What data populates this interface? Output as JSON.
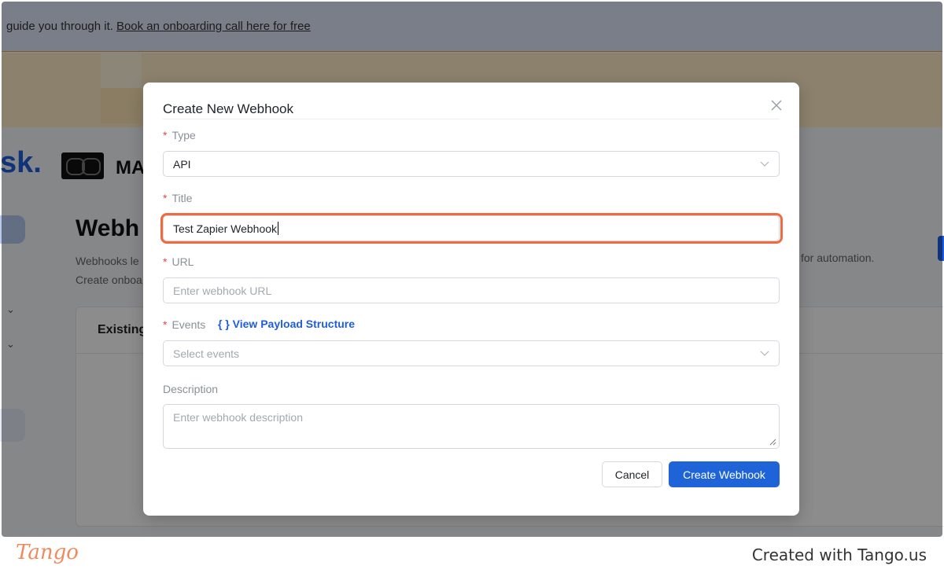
{
  "banner": {
    "text": "guide you through it.",
    "link": "Book an onboarding call here for free"
  },
  "background": {
    "logo_fragment": "sk.",
    "brand_fragment": "MA",
    "page_title_fragment": "Webh",
    "sub_line1_fragment": "Webhooks le",
    "sub_line2_fragment": "Create onboa",
    "right_sub_fragment": "for automation.",
    "card_header_fragment": "Existing"
  },
  "modal": {
    "title": "Create New Webhook",
    "type_label": "Type",
    "type_value": "API",
    "title_label": "Title",
    "title_value": "Test Zapier Webhook",
    "url_label": "URL",
    "url_placeholder": "Enter webhook URL",
    "events_label": "Events",
    "payload_link": "{ } View Payload Structure",
    "events_placeholder": "Select events",
    "description_label": "Description",
    "description_placeholder": "Enter webhook description",
    "cancel_label": "Cancel",
    "create_label": "Create Webhook"
  },
  "footer": {
    "logo": "Tango",
    "text": "Created with Tango.us"
  },
  "colors": {
    "primary": "#1e64d8",
    "focus_ring": "#f06a3f",
    "required": "#e5484d",
    "tango": "#f08a5d"
  }
}
